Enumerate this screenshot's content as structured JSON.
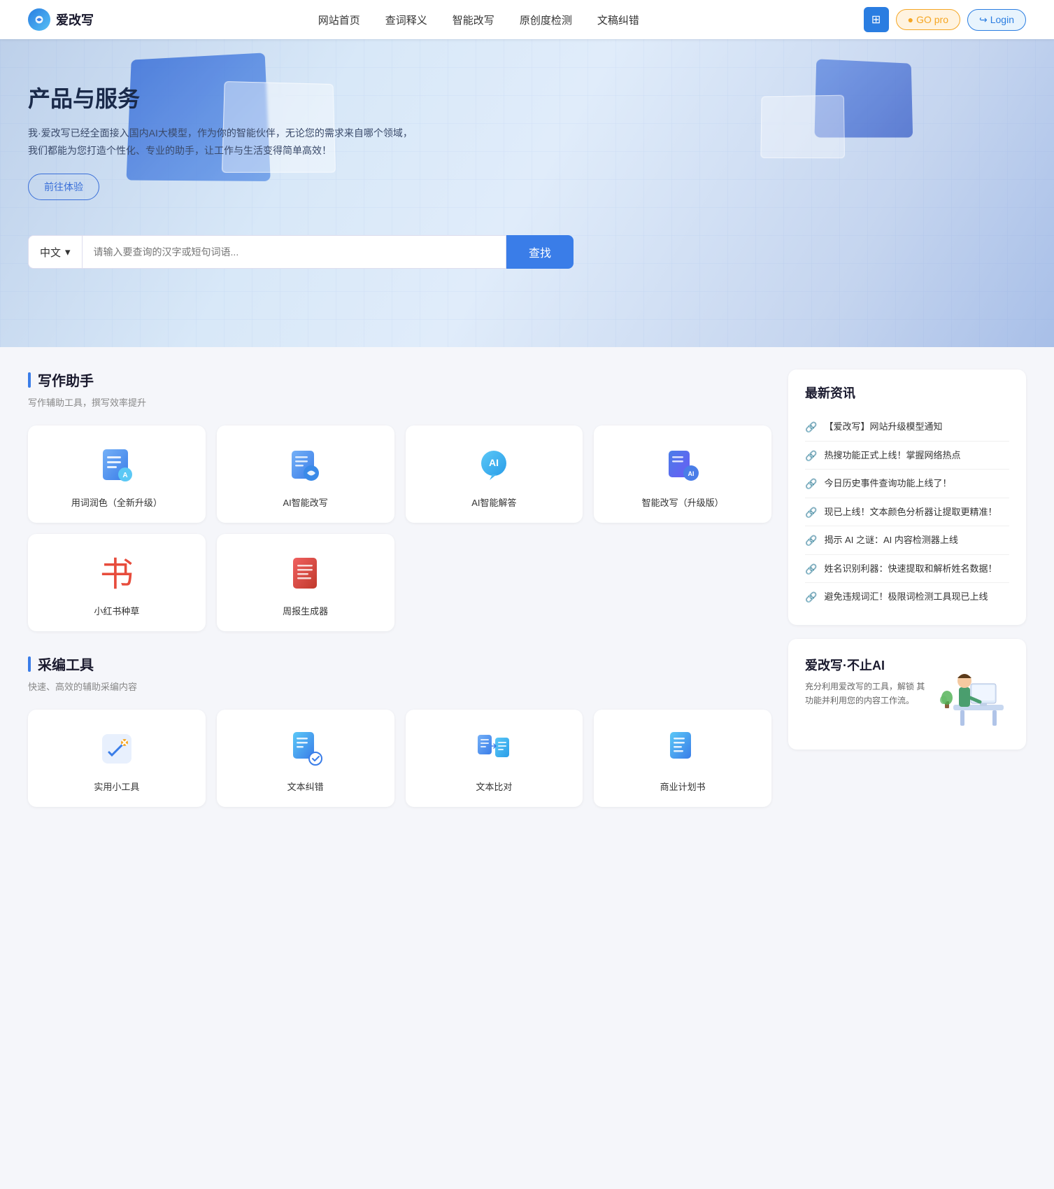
{
  "brand": {
    "name": "爱改写",
    "logo_alt": "爱改写 logo"
  },
  "navbar": {
    "links": [
      {
        "label": "网站首页",
        "id": "home"
      },
      {
        "label": "查词释义",
        "id": "dict"
      },
      {
        "label": "智能改写",
        "id": "rewrite"
      },
      {
        "label": "原创度检测",
        "id": "check"
      },
      {
        "label": "文稿纠错",
        "id": "correct"
      }
    ],
    "btn_grid_label": "⊞",
    "btn_go_label": "GO pro",
    "btn_login_label": "Login"
  },
  "hero": {
    "title": "产品与服务",
    "desc": "我·爱改写已经全面接入国内AI大模型，作为你的智能伙伴，无论您的需求来自哪个领域，我们都能为您打造个性化、专业的助手，让工作与生活变得简单高效！",
    "try_btn": "前往体验",
    "search": {
      "lang": "中文",
      "lang_arrow": "▾",
      "placeholder": "请输入要查询的汉字或短句词语...",
      "btn_label": "查找"
    }
  },
  "writing_section": {
    "title": "写作助手",
    "desc": "写作辅助工具，撰写效率提升",
    "tools": [
      {
        "id": "word-polish",
        "label": "用词润色（全新升级）",
        "icon": "doc"
      },
      {
        "id": "ai-rewrite",
        "label": "AI智能改写",
        "icon": "ai-rewrite"
      },
      {
        "id": "ai-answer",
        "label": "AI智能解答",
        "icon": "ai-answer"
      },
      {
        "id": "smart-rewrite-pro",
        "label": "智能改写（升级版）",
        "icon": "smart-rewrite"
      },
      {
        "id": "xiaohongshu",
        "label": "小红书种草",
        "icon": "book"
      },
      {
        "id": "weekly-report",
        "label": "周报生成器",
        "icon": "report"
      }
    ]
  },
  "editor_section": {
    "title": "采编工具",
    "desc": "快速、高效的辅助采编内容",
    "tools": [
      {
        "id": "practical-tools",
        "label": "实用小工具",
        "icon": "tools"
      },
      {
        "id": "text-proofread",
        "label": "文本纠错",
        "icon": "proofread"
      },
      {
        "id": "text-compare",
        "label": "文本比对",
        "icon": "compare"
      },
      {
        "id": "business-plan",
        "label": "商业计划书",
        "icon": "business"
      }
    ]
  },
  "news_section": {
    "title": "最新资讯",
    "items": [
      {
        "text": "【爱改写】网站升级模型通知"
      },
      {
        "text": "热搜功能正式上线！掌握网络热点"
      },
      {
        "text": "今日历史事件查询功能上线了！"
      },
      {
        "text": "现已上线！文本颜色分析器让提取更精准！"
      },
      {
        "text": "揭示 AI 之谜：AI 内容检测器上线"
      },
      {
        "text": "姓名识别利器：快速提取和解析姓名数据！"
      },
      {
        "text": "避免违规词汇！极限词检测工具现已上线"
      }
    ]
  },
  "promo": {
    "title": "爱改写·不止AI",
    "title_dot": "·",
    "desc": "充分利用爱改写的工具，解锁\n其功能并利用您的内容工作流。"
  }
}
